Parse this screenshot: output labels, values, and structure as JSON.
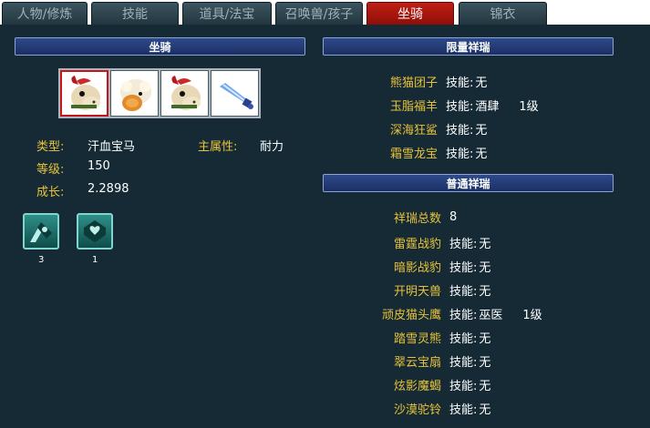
{
  "tabs": [
    "人物/修炼",
    "技能",
    "道具/法宝",
    "召唤兽/孩子",
    "坐骑",
    "锦衣"
  ],
  "active_tab": "坐骑",
  "left": {
    "header": "坐骑",
    "mounts": [
      {
        "icon": "horse-mount-icon",
        "selected": true
      },
      {
        "icon": "sheep-mount-icon",
        "selected": false
      },
      {
        "icon": "horse-mount-icon",
        "selected": false
      },
      {
        "icon": "sword-mount-icon",
        "selected": false
      }
    ],
    "type_label": "类型:",
    "type_value": "汗血宝马",
    "main_attr_label": "主属性:",
    "main_attr_value": "耐力",
    "level_label": "等级:",
    "level_value": "150",
    "growth_label": "成长:",
    "growth_value": "2.2898",
    "skills": [
      {
        "icon": "hoof-skill-icon",
        "count": "3"
      },
      {
        "icon": "heart-shield-skill-icon",
        "count": "1"
      }
    ]
  },
  "limited": {
    "header": "限量祥瑞",
    "items": [
      {
        "name": "熊猫团子",
        "skill_label": "技能:",
        "skill": "无",
        "level": ""
      },
      {
        "name": "玉脂福羊",
        "skill_label": "技能:",
        "skill": "酒肆",
        "level": "1级"
      },
      {
        "name": "深海狂鲨",
        "skill_label": "技能:",
        "skill": "无",
        "level": ""
      },
      {
        "name": "霜雪龙宝",
        "skill_label": "技能:",
        "skill": "无",
        "level": ""
      }
    ]
  },
  "normal": {
    "header": "普通祥瑞",
    "total_label": "祥瑞总数",
    "total_value": "8",
    "items": [
      {
        "name": "雷霆战豹",
        "skill_label": "技能:",
        "skill": "无",
        "level": ""
      },
      {
        "name": "暗影战豹",
        "skill_label": "技能:",
        "skill": "无",
        "level": ""
      },
      {
        "name": "开明天兽",
        "skill_label": "技能:",
        "skill": "无",
        "level": ""
      },
      {
        "name": "顽皮猫头鹰",
        "skill_label": "技能:",
        "skill": "巫医",
        "level": "1级"
      },
      {
        "name": "踏雪灵熊",
        "skill_label": "技能:",
        "skill": "无",
        "level": ""
      },
      {
        "name": "翠云宝扇",
        "skill_label": "技能:",
        "skill": "无",
        "level": ""
      },
      {
        "name": "炫影魔蝎",
        "skill_label": "技能:",
        "skill": "无",
        "level": ""
      },
      {
        "name": "沙漠驼铃",
        "skill_label": "技能:",
        "skill": "无",
        "level": ""
      }
    ]
  },
  "colors": {
    "accent_label": "#e8c23a",
    "active_tab": "#c01f14",
    "background": "#152a34",
    "header": "#1f3670"
  }
}
